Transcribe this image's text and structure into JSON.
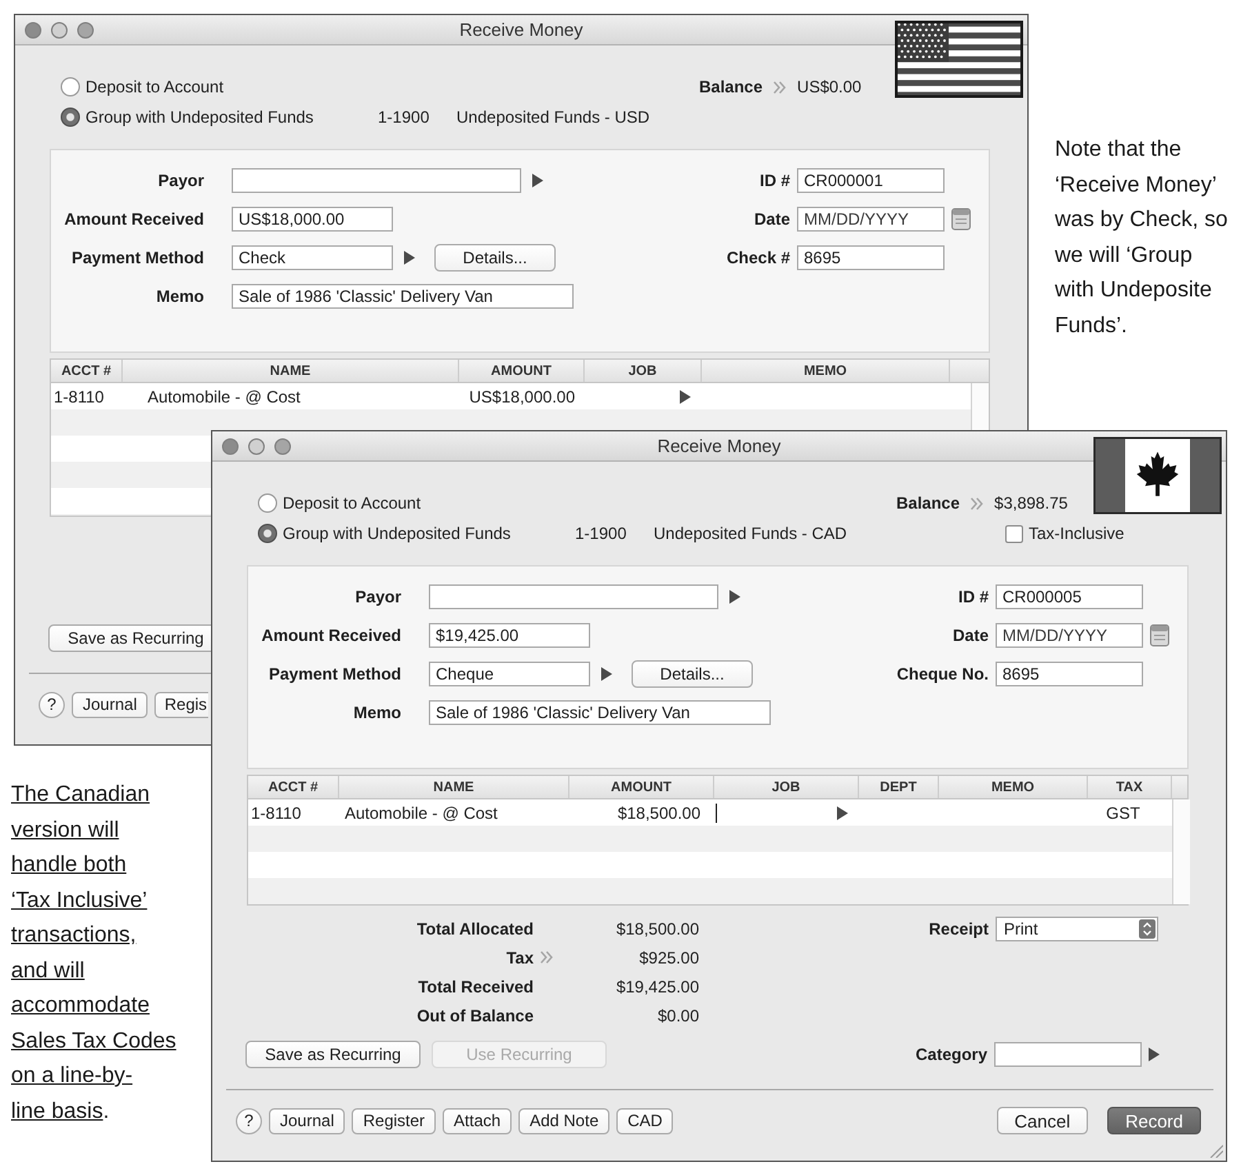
{
  "windows": [
    {
      "kind": "us",
      "title": "Receive Money",
      "deposit_options": [
        {
          "label": "Deposit to Account",
          "selected": false
        },
        {
          "label": "Group with Undeposited Funds",
          "selected": true
        }
      ],
      "account_number": "1-1900",
      "account_name": "Undeposited Funds - USD",
      "balance": {
        "label": "Balance",
        "value": "US$0.00"
      },
      "left_fields": [
        {
          "label": "Payor",
          "lookup": true
        },
        {
          "label": "Amount Received",
          "value": "US$18,000.00"
        },
        {
          "label": "Payment Method",
          "value": "Check",
          "lookup": true,
          "button": "Details..."
        },
        {
          "label": "Memo",
          "value": "Sale of 1986 'Classic' Delivery Van"
        }
      ],
      "right_fields": [
        {
          "label": "ID #",
          "value": "CR000001"
        },
        {
          "label": "Date",
          "placeholder": "MM/DD/YYYY",
          "calendar": true
        },
        {
          "label": "Check #",
          "value": "8695"
        }
      ],
      "table": {
        "columns": [
          {
            "label": "ACCT #",
            "kind": "acct"
          },
          {
            "label": "NAME",
            "kind": "name"
          },
          {
            "label": "AMOUNT",
            "kind": "amount"
          },
          {
            "label": "JOB",
            "kind": "job"
          },
          {
            "label": "MEMO",
            "kind": "memo"
          }
        ],
        "rows": [
          {
            "acct": "1-8110",
            "name": "Automobile - @ Cost",
            "amount": "US$18,000.00",
            "editing": false
          }
        ]
      },
      "actions": [
        {
          "label": "Save as Recurring",
          "disabled": false
        }
      ],
      "footer_buttons": [
        {
          "label": "?",
          "kind": "help"
        },
        {
          "label": "Journal",
          "kind": "plain"
        },
        {
          "label": "Regis",
          "kind": "clipped"
        }
      ]
    },
    {
      "kind": "ca",
      "title": "Receive Money",
      "deposit_options": [
        {
          "label": "Deposit to Account",
          "selected": false
        },
        {
          "label": "Group with Undeposited Funds",
          "selected": true
        }
      ],
      "account_number": "1-1900",
      "account_name": "Undeposited Funds - CAD",
      "balance": {
        "label": "Balance",
        "value": "$3,898.75"
      },
      "tax_inclusive": {
        "label": "Tax-Inclusive",
        "checked": false
      },
      "left_fields": [
        {
          "label": "Payor",
          "lookup": true
        },
        {
          "label": "Amount Received",
          "value": "$19,425.00"
        },
        {
          "label": "Payment Method",
          "value": "Cheque",
          "lookup": true,
          "button": "Details..."
        },
        {
          "label": "Memo",
          "value": "Sale of 1986 'Classic' Delivery Van"
        }
      ],
      "right_fields": [
        {
          "label": "ID #",
          "value": "CR000005"
        },
        {
          "label": "Date",
          "placeholder": "MM/DD/YYYY",
          "calendar": true
        },
        {
          "label": "Cheque No.",
          "value": "8695"
        }
      ],
      "table": {
        "columns": [
          {
            "label": "ACCT #",
            "kind": "acct"
          },
          {
            "label": "NAME",
            "kind": "name"
          },
          {
            "label": "AMOUNT",
            "kind": "amount"
          },
          {
            "label": "JOB",
            "kind": "job"
          },
          {
            "label": "DEPT",
            "kind": "dept"
          },
          {
            "label": "MEMO",
            "kind": "memo"
          },
          {
            "label": "TAX",
            "kind": "tax"
          }
        ],
        "rows": [
          {
            "acct": "1-8110",
            "name": "Automobile - @ Cost",
            "amount": "$18,500.00",
            "tax": "GST",
            "editing": true
          }
        ]
      },
      "totals": [
        {
          "label": "Total Allocated",
          "value": "$18,500.00"
        },
        {
          "label": "Tax",
          "value": "$925.00",
          "link": true
        },
        {
          "label": "Total Received",
          "value": "$19,425.00"
        },
        {
          "label": "Out of Balance",
          "value": "$0.00"
        }
      ],
      "receipt": {
        "label": "Receipt",
        "value": "Print"
      },
      "actions": [
        {
          "label": "Save as Recurring",
          "disabled": false
        },
        {
          "label": "Use Recurring",
          "disabled": true
        }
      ],
      "category": {
        "label": "Category",
        "lookup": true
      },
      "footer_buttons": [
        {
          "label": "?",
          "kind": "help"
        },
        {
          "label": "Journal",
          "kind": "plain"
        },
        {
          "label": "Register",
          "kind": "plain"
        },
        {
          "label": "Attach",
          "kind": "plain"
        },
        {
          "label": "Add Note",
          "kind": "plain"
        },
        {
          "label": "CAD",
          "kind": "plain"
        }
      ],
      "dialog_buttons": [
        {
          "label": "Cancel",
          "primary": false
        },
        {
          "label": "Record",
          "primary": true
        }
      ],
      "resize_grip": true
    }
  ],
  "notes": [
    {
      "lines": [
        "Note that the",
        "‘Receive Money’",
        "was by Check, so",
        "we will ‘Group",
        "with Undeposite",
        "Funds’."
      ],
      "underlined": false
    },
    {
      "lines": [
        "The Canadian",
        "version will",
        "handle both",
        "‘Tax Inclusive’",
        "transactions,",
        "and will",
        "accommodate",
        "Sales Tax Codes",
        "on a line-by-",
        "line basis"
      ],
      "tail": ".",
      "underlined": true
    }
  ]
}
